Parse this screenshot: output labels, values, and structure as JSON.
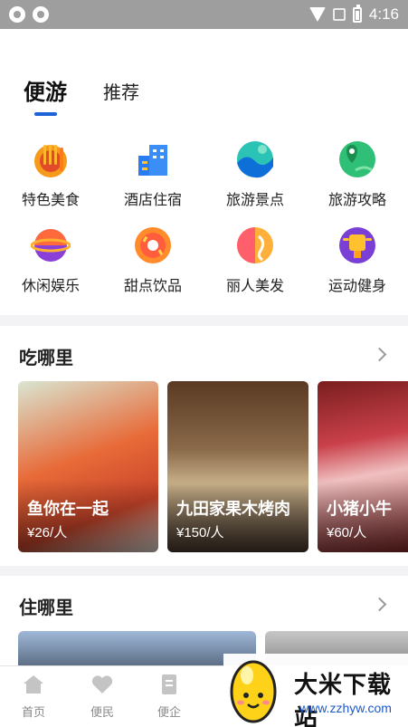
{
  "status_bar": {
    "time": "4:16"
  },
  "tabs": [
    {
      "label": "便游",
      "active": true
    },
    {
      "label": "推荐",
      "active": false
    }
  ],
  "categories": [
    {
      "label": "特色美食",
      "icon": "fork-knife-icon"
    },
    {
      "label": "酒店住宿",
      "icon": "hotel-building-icon"
    },
    {
      "label": "旅游景点",
      "icon": "scenic-wave-icon"
    },
    {
      "label": "旅游攻略",
      "icon": "map-pin-icon"
    },
    {
      "label": "休闲娱乐",
      "icon": "planet-icon"
    },
    {
      "label": "甜点饮品",
      "icon": "donut-icon"
    },
    {
      "label": "丽人美发",
      "icon": "beauty-face-icon"
    },
    {
      "label": "运动健身",
      "icon": "fitness-trophy-icon"
    }
  ],
  "eat_section": {
    "title": "吃哪里",
    "cards": [
      {
        "name": "鱼你在一起",
        "price": "¥26/人"
      },
      {
        "name": "九田家果木烤肉",
        "price": "¥150/人"
      },
      {
        "name": "小猪小牛",
        "price": "¥60/人"
      }
    ]
  },
  "stay_section": {
    "title": "住哪里"
  },
  "bottom_nav": [
    {
      "label": "首页",
      "icon": "home-icon"
    },
    {
      "label": "便民",
      "icon": "heart-icon"
    },
    {
      "label": "便企",
      "icon": "document-icon"
    }
  ],
  "watermark": {
    "title": "大米下载站",
    "url": "www.zzhyw.com"
  },
  "colors": {
    "accent": "#1e63d8",
    "page_bg": "#f3f3f5"
  }
}
